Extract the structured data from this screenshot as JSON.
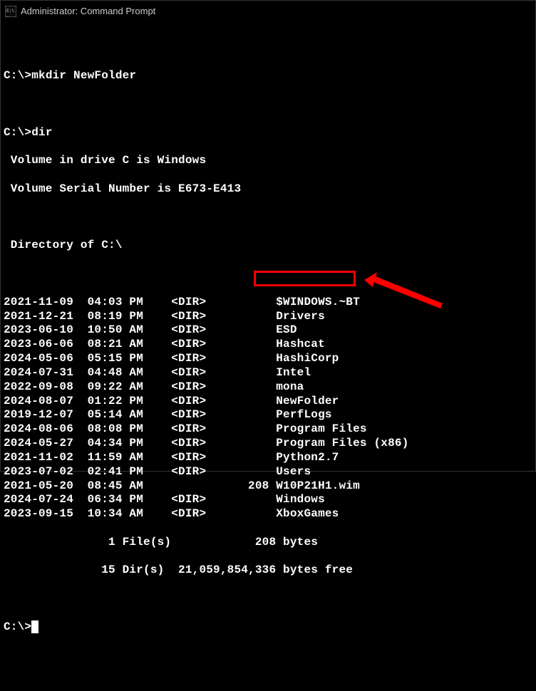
{
  "window": {
    "title": "Administrator: Command Prompt"
  },
  "session": {
    "prompt1": "C:\\>",
    "cmd1": "mkdir NewFolder",
    "prompt2": "C:\\>",
    "cmd2": "dir",
    "volume_line": " Volume in drive C is Windows",
    "serial_line": " Volume Serial Number is E673-E413",
    "directory_line": " Directory of C:\\",
    "entries": [
      {
        "date": "2021-11-09",
        "time": "04:03 PM",
        "type": "<DIR>",
        "size": "",
        "name": "$WINDOWS.~BT"
      },
      {
        "date": "2021-12-21",
        "time": "08:19 PM",
        "type": "<DIR>",
        "size": "",
        "name": "Drivers"
      },
      {
        "date": "2023-06-10",
        "time": "10:50 AM",
        "type": "<DIR>",
        "size": "",
        "name": "ESD"
      },
      {
        "date": "2023-06-06",
        "time": "08:21 AM",
        "type": "<DIR>",
        "size": "",
        "name": "Hashcat"
      },
      {
        "date": "2024-05-06",
        "time": "05:15 PM",
        "type": "<DIR>",
        "size": "",
        "name": "HashiCorp"
      },
      {
        "date": "2024-07-31",
        "time": "04:48 AM",
        "type": "<DIR>",
        "size": "",
        "name": "Intel"
      },
      {
        "date": "2022-09-08",
        "time": "09:22 AM",
        "type": "<DIR>",
        "size": "",
        "name": "mona"
      },
      {
        "date": "2024-08-07",
        "time": "01:22 PM",
        "type": "<DIR>",
        "size": "",
        "name": "NewFolder"
      },
      {
        "date": "2019-12-07",
        "time": "05:14 AM",
        "type": "<DIR>",
        "size": "",
        "name": "PerfLogs"
      },
      {
        "date": "2024-08-06",
        "time": "08:08 PM",
        "type": "<DIR>",
        "size": "",
        "name": "Program Files"
      },
      {
        "date": "2024-05-27",
        "time": "04:34 PM",
        "type": "<DIR>",
        "size": "",
        "name": "Program Files (x86)"
      },
      {
        "date": "2021-11-02",
        "time": "11:59 AM",
        "type": "<DIR>",
        "size": "",
        "name": "Python2.7"
      },
      {
        "date": "2023-07-02",
        "time": "02:41 PM",
        "type": "<DIR>",
        "size": "",
        "name": "Users"
      },
      {
        "date": "2021-05-20",
        "time": "08:45 AM",
        "type": "",
        "size": "208",
        "name": "W10P21H1.wim"
      },
      {
        "date": "2024-07-24",
        "time": "06:34 PM",
        "type": "<DIR>",
        "size": "",
        "name": "Windows"
      },
      {
        "date": "2023-09-15",
        "time": "10:34 AM",
        "type": "<DIR>",
        "size": "",
        "name": "XboxGames"
      }
    ],
    "summary_files": "               1 File(s)            208 bytes",
    "summary_dirs": "              15 Dir(s)  21,059,854,336 bytes free",
    "prompt3": "C:\\>"
  },
  "annotation": {
    "highlighted_entry": "NewFolder"
  }
}
